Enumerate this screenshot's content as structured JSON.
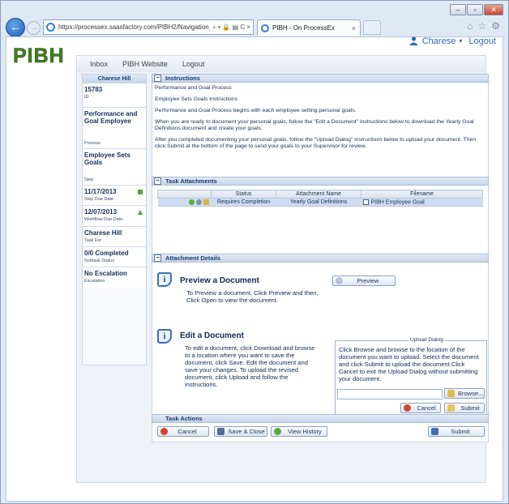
{
  "browser": {
    "url": "https://processex.saasfactory.com/PIBH2/Navigation_Co",
    "address_tools": "⌕ ▾ 🔒 ▤ C ×",
    "tab_title": "PIBH - On ProcessEx",
    "tab_close": "×",
    "minimize": "–",
    "restore": "▫",
    "close": "✕",
    "chrome_icons": {
      "home": "⌂",
      "favorites": "☆",
      "tools": "⚙"
    }
  },
  "header": {
    "logo_text": "PIBH",
    "user_name": "Charese",
    "user_caret": "▾",
    "logout": "Logout"
  },
  "topnav": {
    "items": [
      "Inbox",
      "PIBH Website",
      "Logout"
    ]
  },
  "summary": {
    "header": "Charese Hill",
    "blocks": [
      {
        "value": "15783",
        "label": "ID"
      },
      {
        "value": "Performance and Goal Employee",
        "label": "Process"
      },
      {
        "value": "Employee Sets Goals",
        "label": "Step"
      },
      {
        "value": "11/17/2013",
        "label": "Step Due Date",
        "flag": "green-square"
      },
      {
        "value": "12/07/2013",
        "label": "Workflow Due Date",
        "flag": "green-triangle"
      },
      {
        "value": "Charese Hill",
        "label": "Task For"
      },
      {
        "value": "0/0 Completed",
        "label": "Subtask Status"
      },
      {
        "value": "No Escalation",
        "label": "Escalation"
      }
    ]
  },
  "instructions": {
    "title": "Instructions",
    "toggle": "−",
    "paragraphs": [
      "Performance and Goal Process",
      "Employee Sets Goals Instructions",
      "Performance and Goal Process begins with each employee setting personal goals.",
      "When you are ready to document your personal goals, follow the \"Edit a Document\" instructions below to download the Yearly Goal Definitions document and create your goals.",
      "After you completed documenting your personal goals, follow the \"Upload Dialog\" instructions below to upload your document.  Then click Submit at the bottom of the page to send your goals to your Supervisor for review."
    ]
  },
  "attachments": {
    "title": "Task Attachments",
    "toggle": "−",
    "columns": [
      "",
      "Status",
      "Attachment Name",
      "Filename"
    ],
    "rows": [
      {
        "status": "Requires Completion",
        "name": "Yearly Goal Definitions",
        "filename": "PIBH Employee Goal"
      }
    ]
  },
  "details": {
    "title": "Attachment Details",
    "toggle": "−",
    "info_glyph": "i",
    "preview_title": "Preview a Document",
    "preview_text": "To Preview a document, Click Preview and then, Click Open to view the document.",
    "preview_button": "Preview",
    "edit_title": "Edit a Document",
    "edit_text": "To edit a document, click Download and browse to a location where you want to save the document, click Save. Edit the document and save your changes. To upload the revised document, click Upload and follow the instructions.",
    "upload_legend": "Upload Dialog",
    "upload_text": "Click Browse and browse to the location of the document you want to upload. Select the document and click Submit to upload the document.Click Cancel to exit the Upload Dialog without submitting your document.",
    "browse_button": "Browse...",
    "cancel_button": "Cancel",
    "submit_button": "Submit"
  },
  "task_actions": {
    "title": "Task Actions",
    "cancel": "Cancel",
    "save_close": "Save & Close",
    "view_history": "View History",
    "submit": "Submit"
  },
  "colors": {
    "brand_green": "#3f7f20",
    "link_blue": "#2e69b8",
    "panel_header": "#c7d6ea",
    "row_selected": "#cfdcf0"
  }
}
